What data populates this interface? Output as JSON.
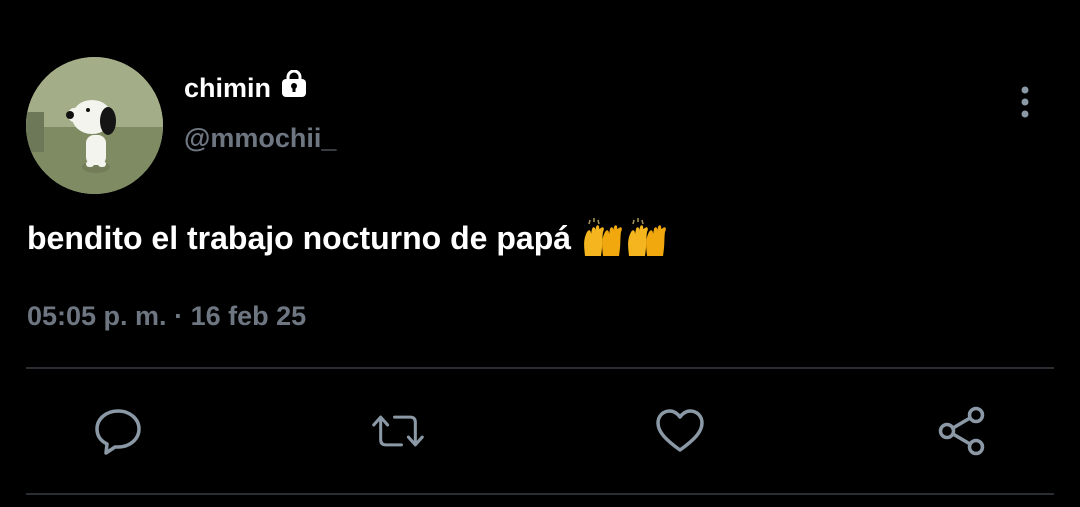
{
  "user": {
    "display_name": "chimin",
    "handle": "@mmochii_",
    "avatar": "snoopy-avatar",
    "protected_icon": "lock-icon"
  },
  "tweet": {
    "text": "bendito el trabajo nocturno de papá",
    "emoji": "raising-hands-emoji-x2",
    "time": "05:05 p. m.",
    "separator": "·",
    "date": "16 feb 25"
  },
  "actions": {
    "reply_icon": "reply-icon",
    "retweet_icon": "retweet-icon",
    "like_icon": "heart-icon",
    "share_icon": "share-icon",
    "more_icon": "more-vertical-icon"
  },
  "colors": {
    "background": "#000000",
    "text_primary": "#ffffff",
    "text_secondary": "#6e7681",
    "icon": "#8b98a5",
    "divider": "#2a2d31"
  }
}
